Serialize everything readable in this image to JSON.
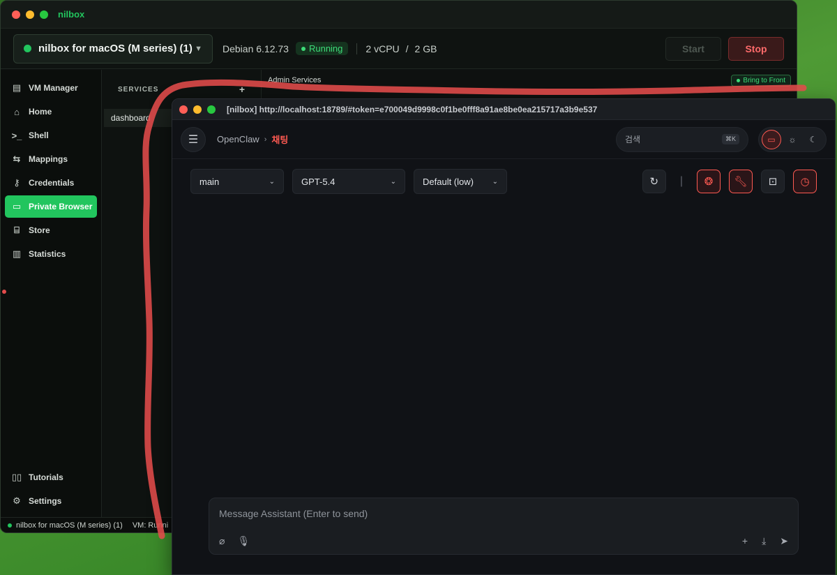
{
  "desktop": {},
  "back_window": {
    "title": "nilbox",
    "vm": {
      "name": "nilbox for macOS (M series) (1)",
      "os": "Debian 6.12.73",
      "status": "Running",
      "cpu": "2 vCPU",
      "slash": "/",
      "memory": "2 GB",
      "start_label": "Start",
      "stop_label": "Stop"
    },
    "sidebar": {
      "items": [
        {
          "label": "VM Manager",
          "icon": "server-icon"
        },
        {
          "label": "Home",
          "icon": "home-icon"
        },
        {
          "label": "Shell",
          "icon": "terminal-icon"
        },
        {
          "label": "Mappings",
          "icon": "arrows-icon"
        },
        {
          "label": "Credentials",
          "icon": "key-icon"
        },
        {
          "label": "Private Browser",
          "icon": "browser-icon",
          "active": true
        },
        {
          "label": "Store",
          "icon": "store-icon"
        },
        {
          "label": "Statistics",
          "icon": "chart-icon"
        }
      ],
      "bottom_items": [
        {
          "label": "Tutorials",
          "icon": "book-icon"
        },
        {
          "label": "Settings",
          "icon": "gear-icon"
        }
      ]
    },
    "services": {
      "header": "SERVICES",
      "add": "+",
      "items": [
        "dashboard"
      ]
    },
    "admin": {
      "title": "Admin Services",
      "bring_to_front": "Bring to Front"
    },
    "statusbar": {
      "vm_name": "nilbox for macOS (M series) (1)",
      "vm_state": "VM: Runni"
    }
  },
  "front_window": {
    "title": "[nilbox] http://localhost:18789/#token=e700049d9998c0f1be0fff8a91ae8be0ea215717a3b9e537",
    "breadcrumb": {
      "root": "OpenClaw",
      "current": "채팅"
    },
    "search": {
      "placeholder": "검색",
      "shortcut": "⌘K"
    },
    "selects": {
      "agent": "main",
      "model": "GPT-5.4",
      "mode": "Default (low)"
    },
    "composer": {
      "placeholder": "Message Assistant (Enter to send)"
    }
  },
  "colors": {
    "accent_green": "#22c55e",
    "accent_red": "#ff5a52",
    "annotation_stroke": "#e24b4b"
  }
}
